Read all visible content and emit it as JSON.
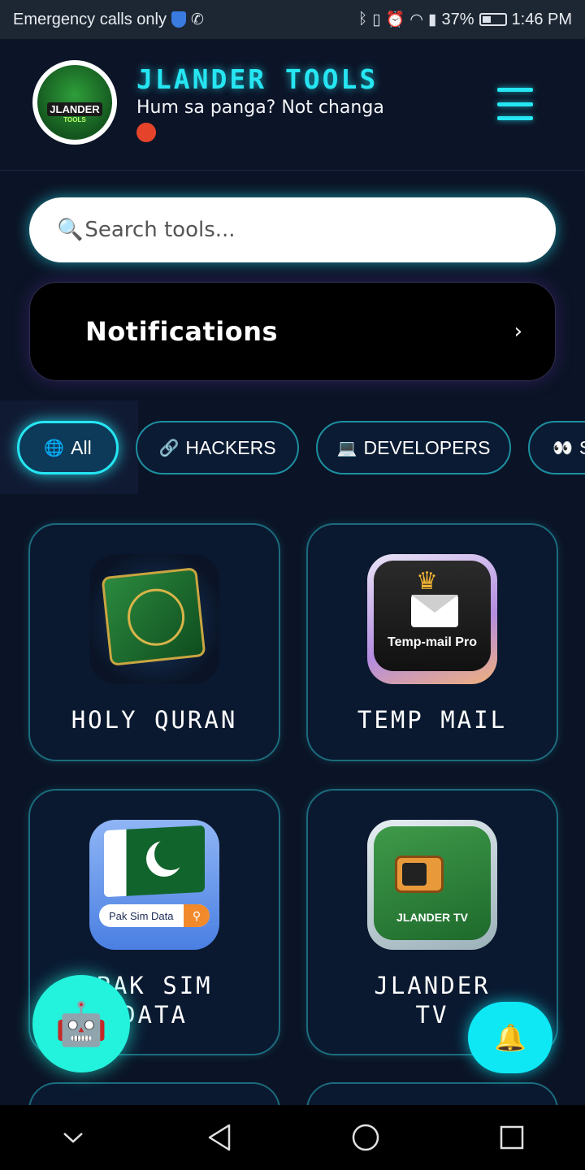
{
  "status_bar": {
    "carrier": "Emergency calls only",
    "battery": "37%",
    "time": "1:46 PM"
  },
  "header": {
    "title": "JLANDER TOOLS",
    "subtitle": "Hum sa panga? Not changa",
    "logo_text_main": "JLANDER",
    "logo_text_sub": "TOOLS"
  },
  "search": {
    "placeholder": "Search tools..."
  },
  "notifications": {
    "label": "Notifications",
    "chevron": "›"
  },
  "categories": [
    {
      "icon": "🌐",
      "label": "All",
      "active": true
    },
    {
      "icon": "🔗",
      "label": "HACKERS",
      "active": false
    },
    {
      "icon": "💻",
      "label": "DEVELOPERS",
      "active": false
    },
    {
      "icon": "👀",
      "label": "S",
      "active": false
    }
  ],
  "tools": [
    {
      "title": "HOLY QURAN",
      "icon": "quran-icon"
    },
    {
      "title": "TEMP MAIL",
      "icon": "temp-mail-icon",
      "icon_label": "Temp-mail Pro"
    },
    {
      "title": "PAK SIM DATA",
      "title_line1": "PAK SIM",
      "title_line2": "DATA",
      "icon": "pak-sim-icon",
      "icon_label": "Pak Sim Data"
    },
    {
      "title": "JLANDER TV",
      "title_line1": "JLANDER",
      "title_line2": "TV",
      "icon": "jlander-tv-icon",
      "icon_label": "JLANDER TV"
    }
  ],
  "fabs": {
    "bot_icon": "robot-icon",
    "bell_icon": "bell-icon"
  },
  "colors": {
    "accent": "#25e6f2",
    "background": "#0b1426",
    "card_border": "#1b6b7c"
  }
}
